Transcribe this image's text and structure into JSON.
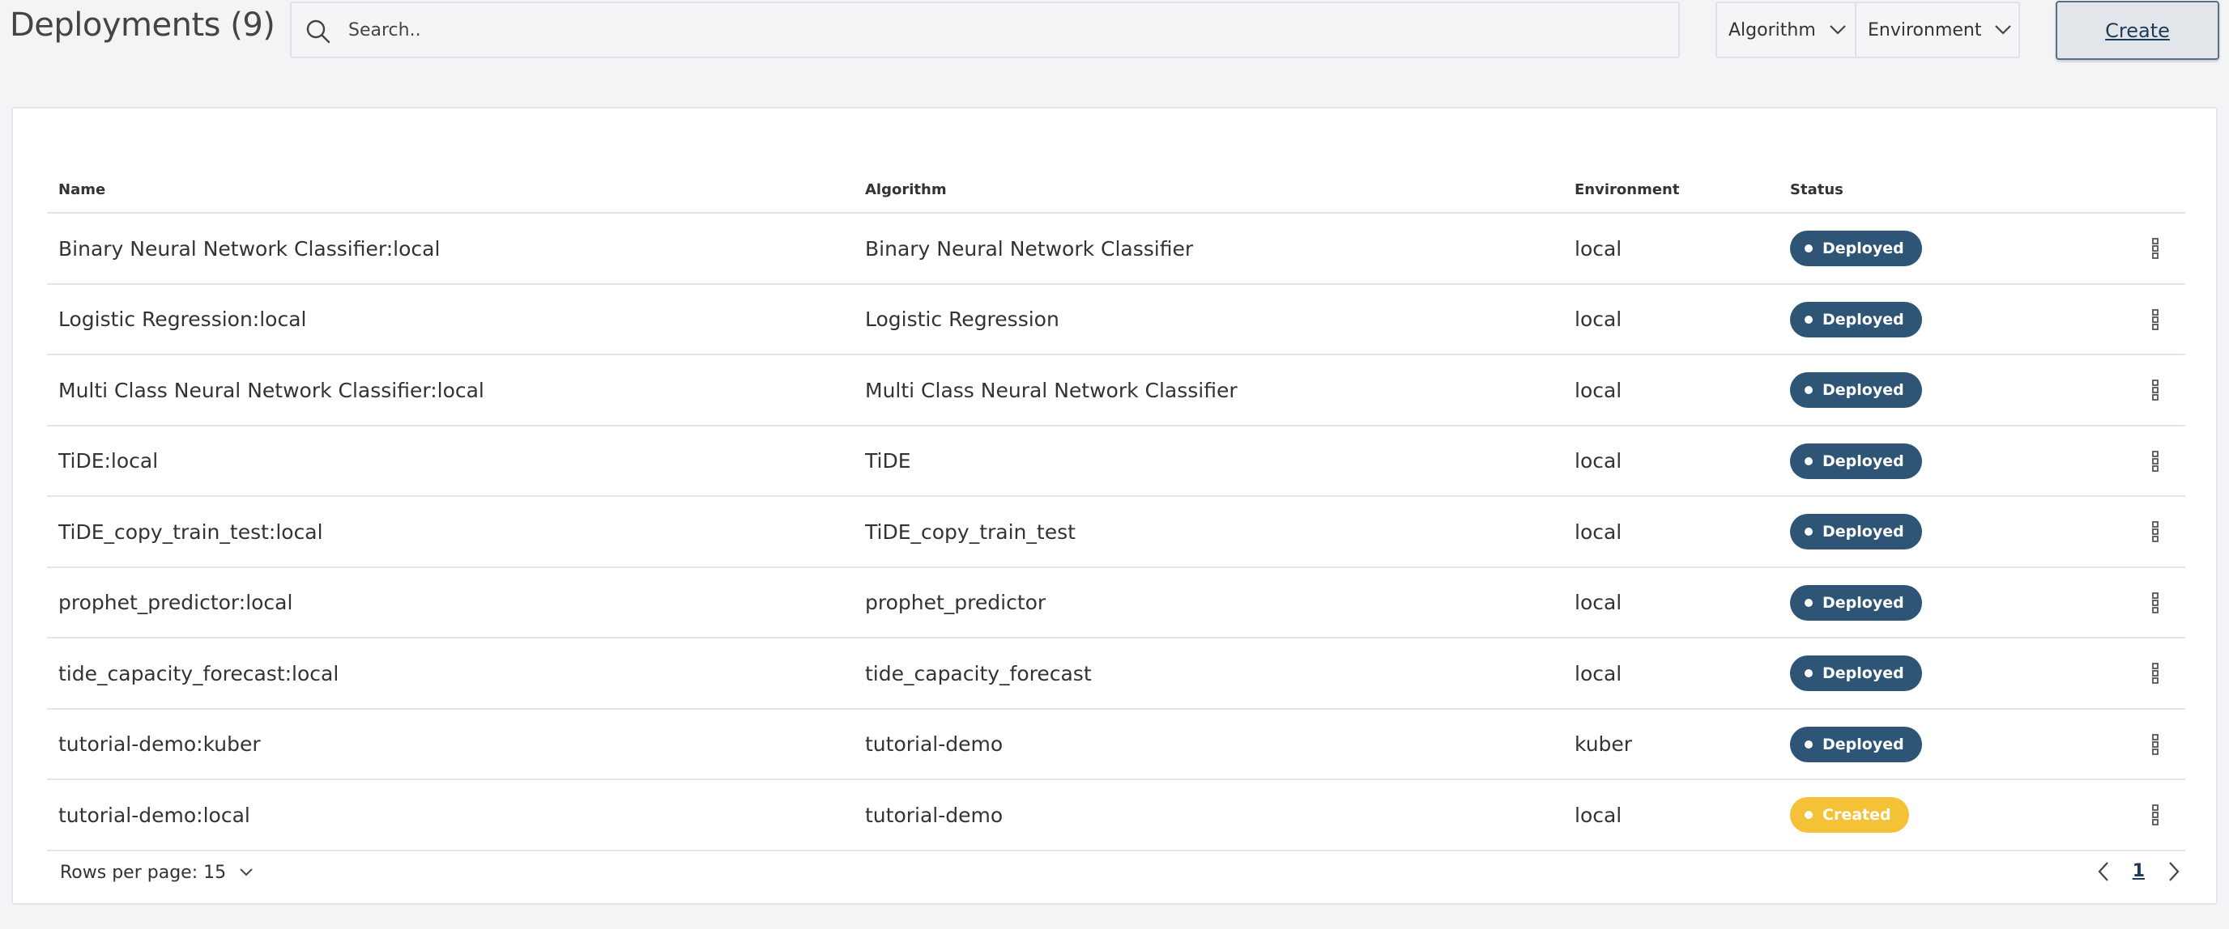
{
  "header": {
    "title": "Deployments (9)",
    "search_placeholder": "Search..",
    "filters": {
      "algorithm": "Algorithm",
      "environment": "Environment"
    },
    "create_label": "Create"
  },
  "table": {
    "columns": {
      "name": "Name",
      "algorithm": "Algorithm",
      "environment": "Environment",
      "status": "Status"
    },
    "rows": [
      {
        "name": "Binary Neural Network Classifier:local",
        "algorithm": "Binary Neural Network Classifier",
        "environment": "local",
        "status": "Deployed"
      },
      {
        "name": "Logistic Regression:local",
        "algorithm": "Logistic Regression",
        "environment": "local",
        "status": "Deployed"
      },
      {
        "name": "Multi Class Neural Network Classifier:local",
        "algorithm": "Multi Class Neural Network Classifier",
        "environment": "local",
        "status": "Deployed"
      },
      {
        "name": "TiDE:local",
        "algorithm": "TiDE",
        "environment": "local",
        "status": "Deployed"
      },
      {
        "name": "TiDE_copy_train_test:local",
        "algorithm": "TiDE_copy_train_test",
        "environment": "local",
        "status": "Deployed"
      },
      {
        "name": "prophet_predictor:local",
        "algorithm": "prophet_predictor",
        "environment": "local",
        "status": "Deployed"
      },
      {
        "name": "tide_capacity_forecast:local",
        "algorithm": "tide_capacity_forecast",
        "environment": "local",
        "status": "Deployed"
      },
      {
        "name": "tutorial-demo:kuber",
        "algorithm": "tutorial-demo",
        "environment": "kuber",
        "status": "Deployed"
      },
      {
        "name": "tutorial-demo:local",
        "algorithm": "tutorial-demo",
        "environment": "local",
        "status": "Created"
      }
    ]
  },
  "pagination": {
    "rows_per_page": "Rows per page: 15",
    "current_page": "1"
  },
  "colors": {
    "deployed": "#2e5575",
    "created": "#f5c136",
    "accent": "#1f3a56"
  },
  "icons": {
    "search": "search-icon",
    "dropdown": "chevron-down-icon",
    "row_menu": "more-vertical-icon",
    "prev": "chevron-left-icon",
    "next": "chevron-right-icon"
  }
}
